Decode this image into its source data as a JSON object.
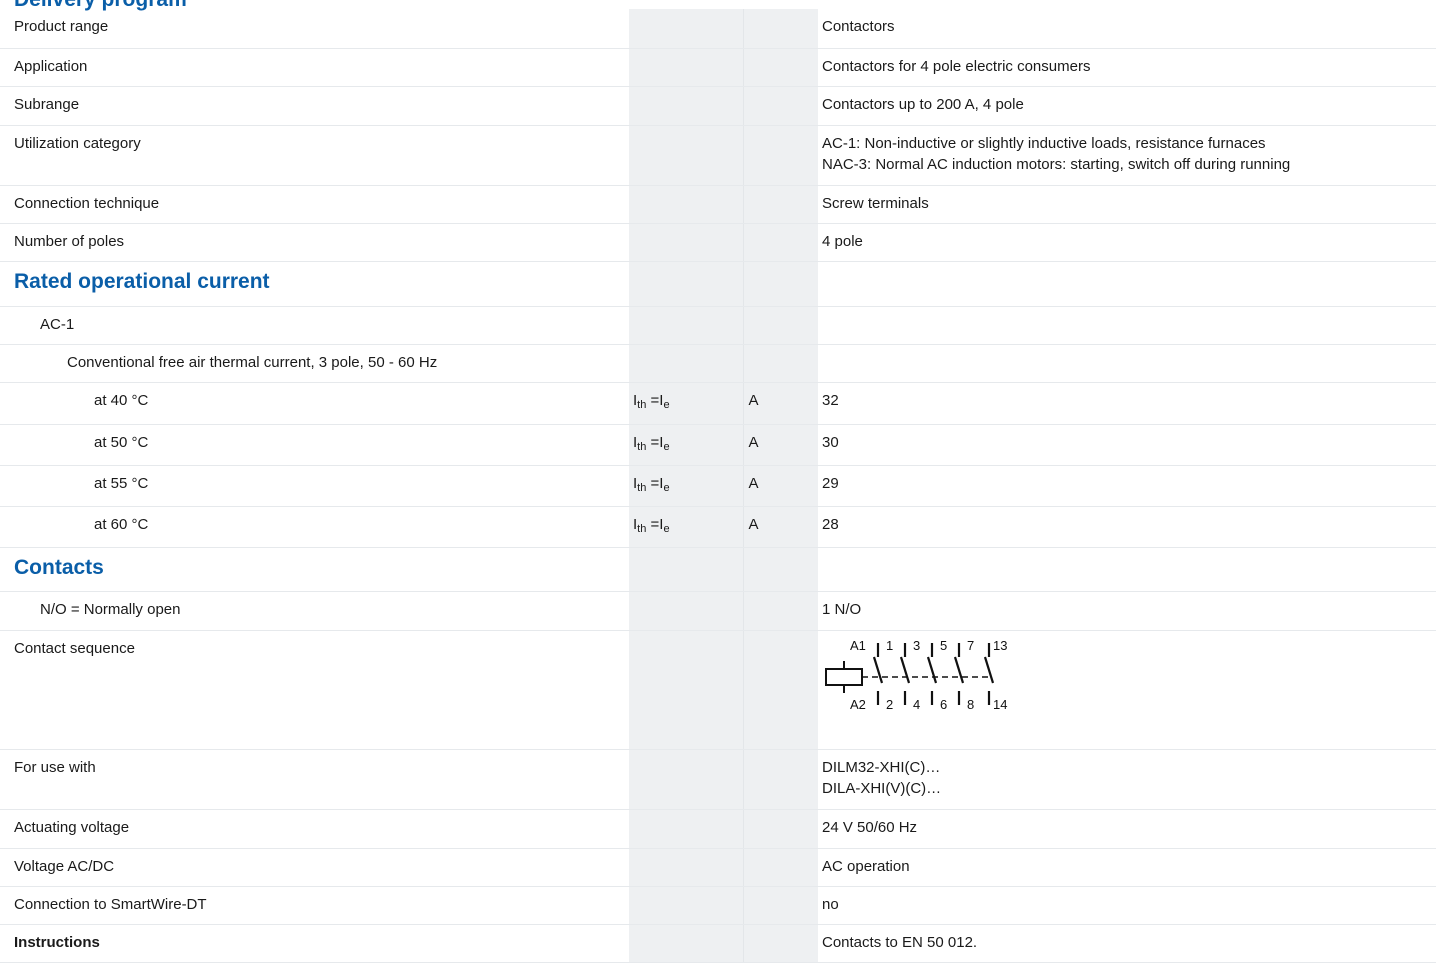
{
  "top_heading_fragment": "Delivery program",
  "sections": {
    "rated_operational_current": "Rated operational current",
    "contacts": "Contacts"
  },
  "rows": {
    "product_range": {
      "label": "Product range",
      "value": "Contactors"
    },
    "application": {
      "label": "Application",
      "value": "Contactors for 4 pole electric consumers"
    },
    "subrange": {
      "label": "Subrange",
      "value": "Contactors up to 200 A, 4 pole"
    },
    "utilization_category": {
      "label": "Utilization category",
      "values": [
        "AC-1: Non-inductive or slightly inductive loads, resistance furnaces",
        "NAC-3: Normal AC induction motors: starting, switch off during running"
      ]
    },
    "connection_technique": {
      "label": "Connection technique",
      "value": "Screw terminals"
    },
    "number_of_poles": {
      "label": "Number of poles",
      "value": "4 pole"
    },
    "ac1": {
      "label": "AC-1"
    },
    "conventional_current": {
      "label": "Conventional free air thermal current, 3 pole, 50 - 60 Hz"
    },
    "temps": [
      {
        "label": "at 40 °C",
        "symbol_main1": "I",
        "symbol_sub1": "th",
        "symbol_eq": " =I",
        "symbol_sub2": "e",
        "unit": "A",
        "value": "32"
      },
      {
        "label": "at 50 °C",
        "symbol_main1": "I",
        "symbol_sub1": "th",
        "symbol_eq": " =I",
        "symbol_sub2": "e",
        "unit": "A",
        "value": "30"
      },
      {
        "label": "at 55 °C",
        "symbol_main1": "I",
        "symbol_sub1": "th",
        "symbol_eq": " =I",
        "symbol_sub2": "e",
        "unit": "A",
        "value": "29"
      },
      {
        "label": "at 60 °C",
        "symbol_main1": "I",
        "symbol_sub1": "th",
        "symbol_eq": " =I",
        "symbol_sub2": "e",
        "unit": "A",
        "value": "28"
      }
    ],
    "normally_open": {
      "label": "N/O = Normally open",
      "value": "1 N/O"
    },
    "contact_sequence": {
      "label": "Contact sequence",
      "diagram_top_labels": [
        "A1",
        "1",
        "3",
        "5",
        "7",
        "13"
      ],
      "diagram_bottom_labels": [
        "A2",
        "2",
        "4",
        "6",
        "8",
        "14"
      ]
    },
    "for_use_with": {
      "label": "For use with",
      "values": [
        "DILM32-XHI(C)…",
        "DILA-XHI(V)(C)…"
      ]
    },
    "actuating_voltage": {
      "label": "Actuating voltage",
      "value": "24 V 50/60 Hz"
    },
    "voltage_ac_dc": {
      "label": "Voltage AC/DC",
      "value": "AC operation"
    },
    "smartwire": {
      "label": "Connection to SmartWire-DT",
      "value": "no"
    },
    "instructions": {
      "label": "Instructions",
      "value": "Contacts to EN 50 012."
    }
  }
}
